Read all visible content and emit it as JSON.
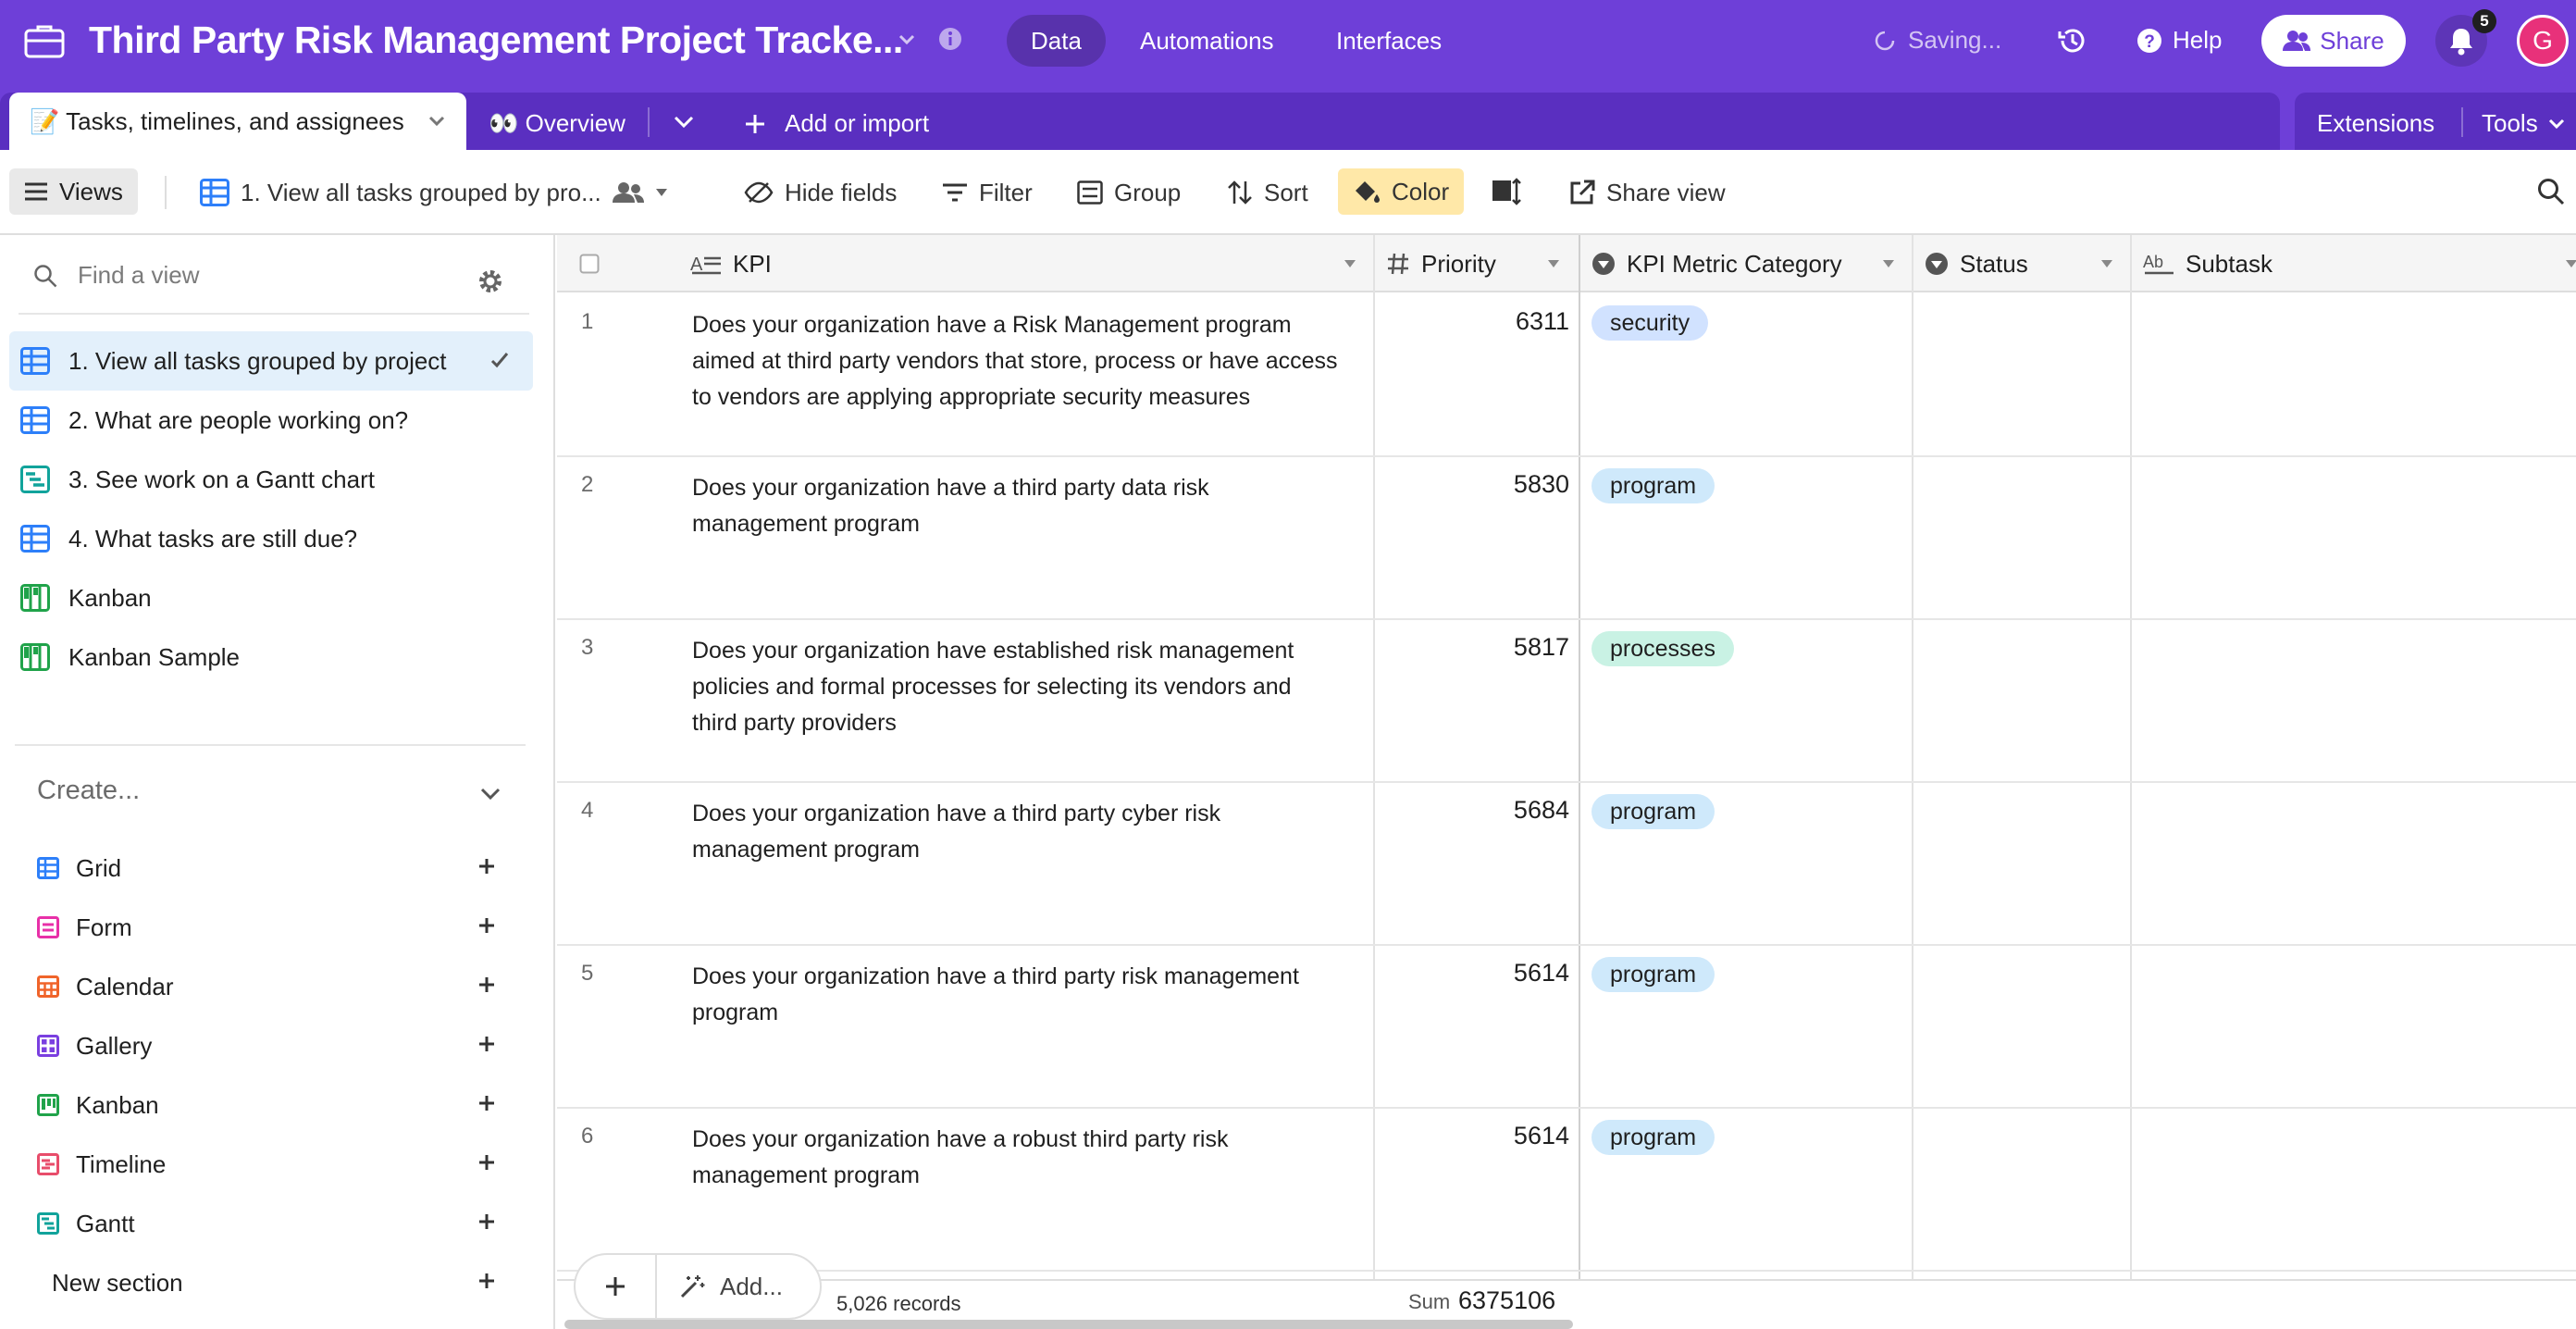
{
  "header": {
    "title": "Third Party Risk Management Project Tracke...",
    "nav": [
      "Data",
      "Automations",
      "Interfaces"
    ],
    "saving": "Saving...",
    "help": "Help",
    "share": "Share",
    "notifications": "5",
    "avatar_initial": "G",
    "accent_color": "#6e3fd8"
  },
  "tabs": {
    "active": "📝 Tasks, timelines, and assignees",
    "second": "👀 Overview",
    "add_import": "Add or import",
    "extensions": "Extensions",
    "tools": "Tools"
  },
  "viewbar": {
    "views": "Views",
    "current_view": "1. View all tasks grouped by pro...",
    "hide_fields": "Hide fields",
    "filter": "Filter",
    "group": "Group",
    "sort": "Sort",
    "color": "Color",
    "share_view": "Share view"
  },
  "sidebar": {
    "find_placeholder": "Find a view",
    "views": [
      {
        "label": "1. View all tasks grouped by project",
        "icon": "grid-view-icon"
      },
      {
        "label": "2. What are people working on?",
        "icon": "grid-view-icon"
      },
      {
        "label": "3. See work on a Gantt chart",
        "icon": "gantt-view-icon"
      },
      {
        "label": "4. What tasks are still due?",
        "icon": "grid-view-icon"
      },
      {
        "label": "Kanban",
        "icon": "kanban-view-icon"
      },
      {
        "label": "Kanban Sample",
        "icon": "kanban-view-icon"
      }
    ],
    "create_label": "Create...",
    "create_items": [
      {
        "label": "Grid",
        "color": "#2d7ff9"
      },
      {
        "label": "Form",
        "color": "#e830a8"
      },
      {
        "label": "Calendar",
        "color": "#f0642a"
      },
      {
        "label": "Gallery",
        "color": "#7a3fe0"
      },
      {
        "label": "Kanban",
        "color": "#20a34a"
      },
      {
        "label": "Timeline",
        "color": "#e84d6b"
      },
      {
        "label": "Gantt",
        "color": "#11a39b"
      }
    ],
    "new_section": "New section"
  },
  "grid": {
    "columns": [
      "KPI",
      "Priority",
      "KPI Metric Category",
      "Status",
      "Subtask"
    ],
    "rows": [
      {
        "num": "1",
        "kpi": "Does your organization have a Risk Management program aimed at third party vendors that store, process or have access to vendors are applying appropriate security measures",
        "priority": "6311",
        "category": "security",
        "cat_color": "#d1e2ff"
      },
      {
        "num": "2",
        "kpi": "Does your organization have a third party data risk management program",
        "priority": "5830",
        "category": "program",
        "cat_color": "#cfe9fb"
      },
      {
        "num": "3",
        "kpi": "Does your organization have established risk management policies and formal processes for selecting its vendors and third party providers",
        "priority": "5817",
        "category": "processes",
        "cat_color": "#c9f2e4"
      },
      {
        "num": "4",
        "kpi": "Does your organization have a third party cyber risk management program",
        "priority": "5684",
        "category": "program",
        "cat_color": "#cfe9fb"
      },
      {
        "num": "5",
        "kpi": "Does your organization have a third party risk management program",
        "priority": "5614",
        "category": "program",
        "cat_color": "#cfe9fb"
      },
      {
        "num": "6",
        "kpi": "Does your organization have a robust third party risk management program",
        "priority": "5614",
        "category": "program",
        "cat_color": "#cfe9fb"
      }
    ]
  },
  "footer": {
    "add_label": "Add...",
    "records": "5,026 records",
    "sum_label": "Sum",
    "sum_value": "6375106"
  }
}
